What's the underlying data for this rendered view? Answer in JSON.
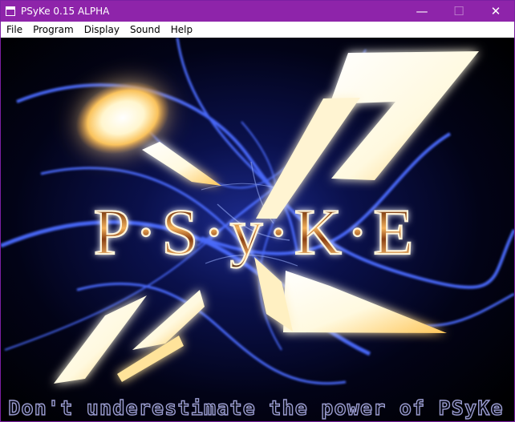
{
  "window": {
    "title": "PSyKe 0.15 ALPHA",
    "controls": {
      "minimize": "—",
      "maximize": "☐",
      "close": "✕"
    }
  },
  "menu": {
    "items": [
      {
        "label": "File"
      },
      {
        "label": "Program"
      },
      {
        "label": "Display"
      },
      {
        "label": "Sound"
      },
      {
        "label": "Help"
      }
    ]
  },
  "splash": {
    "logo_text": "P·S·y·K·E",
    "tagline": "Don't underestimate the power of PSyKe"
  },
  "colors": {
    "title_bar": "#8e24aa",
    "window_border": "#7b1fa2",
    "menu_bg": "#ffffff",
    "canvas_bg": "#000000",
    "blue_energy": "#3555ff",
    "gold_glow": "#ffcc55",
    "white_core": "#ffffff",
    "logo_bronze": "#c57922",
    "tagline_outline": "#8a8cc4"
  }
}
